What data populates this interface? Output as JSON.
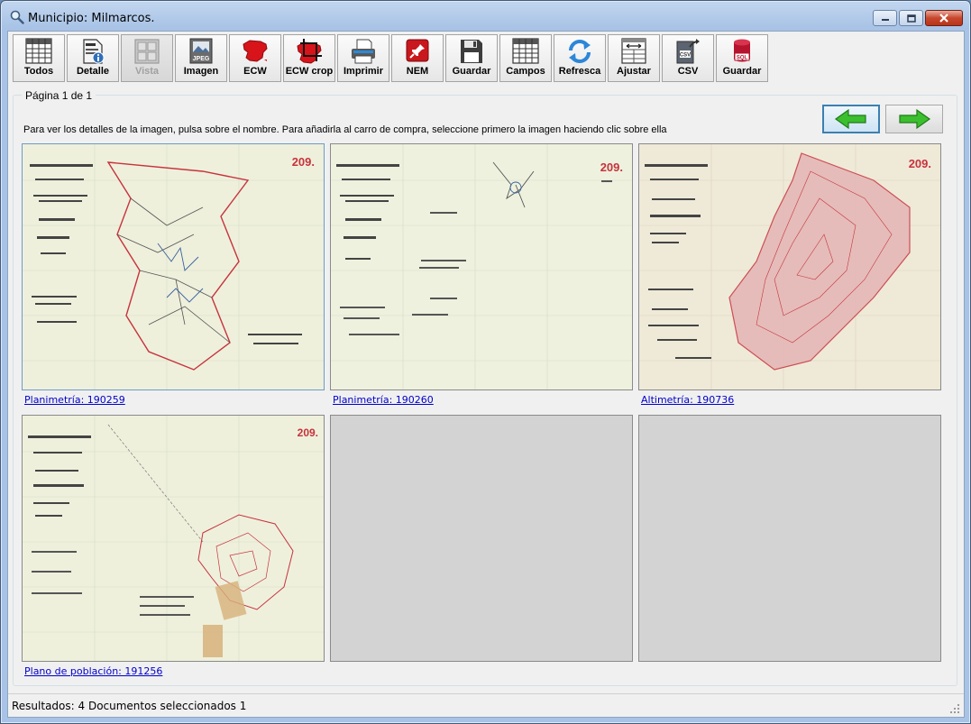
{
  "window": {
    "title": "Municipio: Milmarcos."
  },
  "toolbar": [
    {
      "label": "Todos",
      "icon": "grid-icon",
      "enabled": true
    },
    {
      "label": "Detalle",
      "icon": "document-info-icon",
      "enabled": true
    },
    {
      "label": "Vista",
      "icon": "thumbnails-icon",
      "enabled": false
    },
    {
      "label": "Imagen",
      "icon": "jpeg-image-icon",
      "enabled": true
    },
    {
      "label": "ECW",
      "icon": "spain-map-icon",
      "enabled": true
    },
    {
      "label": "ECW crop",
      "icon": "spain-map-crop-icon",
      "enabled": true
    },
    {
      "label": "Imprimir",
      "icon": "printer-icon",
      "enabled": true
    },
    {
      "label": "NEM",
      "icon": "pushpin-icon",
      "enabled": true
    },
    {
      "label": "Guardar",
      "icon": "floppy-disk-icon",
      "enabled": true
    },
    {
      "label": "Campos",
      "icon": "columns-grid-icon",
      "enabled": true
    },
    {
      "label": "Refresca",
      "icon": "refresh-icon",
      "enabled": true
    },
    {
      "label": "Ajustar",
      "icon": "fit-columns-icon",
      "enabled": true
    },
    {
      "label": "CSV",
      "icon": "csv-export-icon",
      "enabled": true
    },
    {
      "label": "Guardar",
      "icon": "sql-database-icon",
      "enabled": true
    }
  ],
  "group": {
    "legend": "Página 1 de 1"
  },
  "hint": "Para ver los detalles de la imagen, pulsa sobre el nombre. Para añadirla al carro de compra, seleccione primero la imagen haciendo clic sobre ella",
  "nav": {
    "prev_icon": "arrow-left-icon",
    "next_icon": "arrow-right-icon"
  },
  "results": [
    {
      "caption": "Planimetría: 190259",
      "sheet_number": "209.",
      "selected": true
    },
    {
      "caption": "Planimetría: 190260",
      "sheet_number": "209.",
      "selected": false
    },
    {
      "caption": "Altimetría: 190736",
      "sheet_number": "209.",
      "selected": false
    },
    {
      "caption": "Plano de población: 191256",
      "sheet_number": "209.",
      "selected": false
    }
  ],
  "status": {
    "text": "Resultados: 4  Documentos seleccionados 1"
  },
  "colors": {
    "accent": "#3c7fb1",
    "link": "#0000cc",
    "map_paper": "#eef0dc",
    "map_red": "#c8323c"
  }
}
